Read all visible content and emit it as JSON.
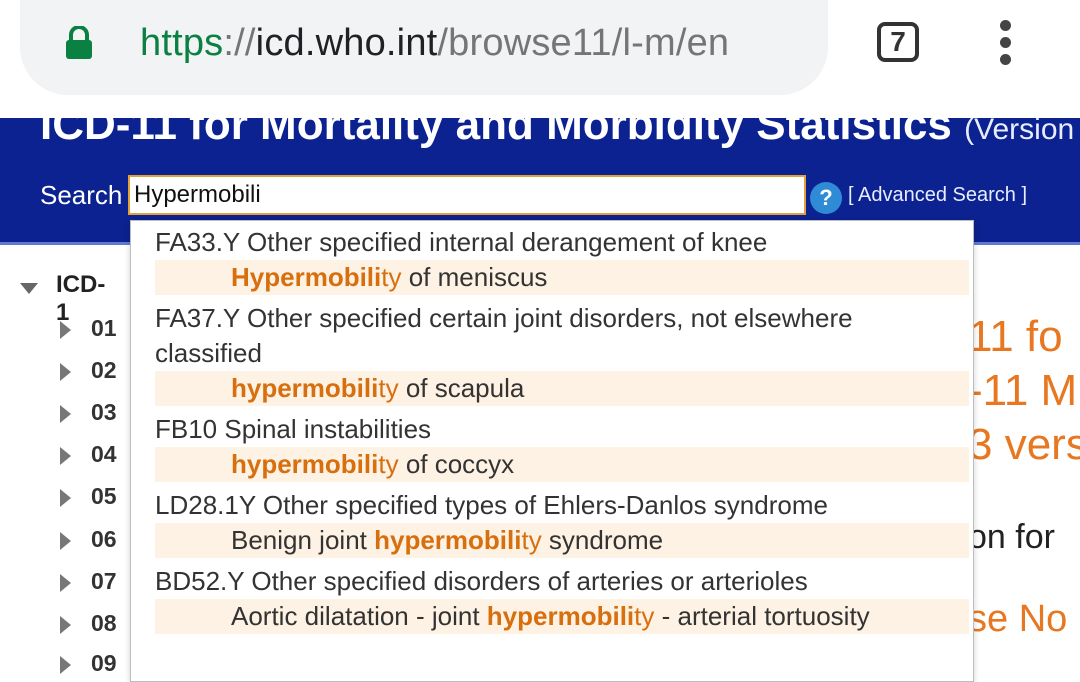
{
  "browser": {
    "url_scheme": "https",
    "url_sep": "://",
    "url_host": "icd.who.int",
    "url_path": "/browse11/l-m/en",
    "tab_count": "7"
  },
  "header": {
    "title": "ICD-11 for Mortality and Morbidity Statistics",
    "version_fragment": "(Version",
    "search_label": "Search",
    "search_value": "Hypermobili",
    "help_glyph": "?",
    "advanced_search": "[ Advanced Search ]"
  },
  "tree": {
    "root_label": "ICD-1",
    "chapters": [
      "01",
      "02",
      "03",
      "04",
      "05",
      "06",
      "07",
      "08",
      "09"
    ]
  },
  "background_text": {
    "line1": "11 fo",
    "line2": "-11 M",
    "line3": "3 vers",
    "line4": "on for",
    "line5": "se No"
  },
  "suggestions": [
    {
      "code_title": "FA33.Y Other specified internal derangement of knee",
      "match": {
        "before": "",
        "bold": "Hypermobili",
        "rest": "ty",
        "after": " of meniscus"
      }
    },
    {
      "code_title": "FA37.Y Other specified certain joint disorders, not elsewhere classified",
      "match": {
        "before": "",
        "bold": "hypermobili",
        "rest": "ty",
        "after": " of scapula"
      }
    },
    {
      "code_title": "FB10 Spinal instabilities",
      "match": {
        "before": "",
        "bold": "hypermobili",
        "rest": "ty",
        "after": " of coccyx"
      }
    },
    {
      "code_title": "LD28.1Y Other specified types of Ehlers-Danlos syndrome",
      "match": {
        "before": "Benign joint ",
        "bold": "hypermobili",
        "rest": "ty",
        "after": " syndrome"
      }
    },
    {
      "code_title": "BD52.Y Other specified disorders of arteries or arterioles",
      "match": {
        "before": "Aortic dilatation - joint ",
        "bold": "hypermobili",
        "rest": "ty",
        "after": " - arterial tortuosity"
      }
    }
  ],
  "colors": {
    "header_bg": "#0b2290",
    "highlight": "#d76f0e",
    "match_bg": "#fdf2e3",
    "secure_green": "#0b8043"
  }
}
